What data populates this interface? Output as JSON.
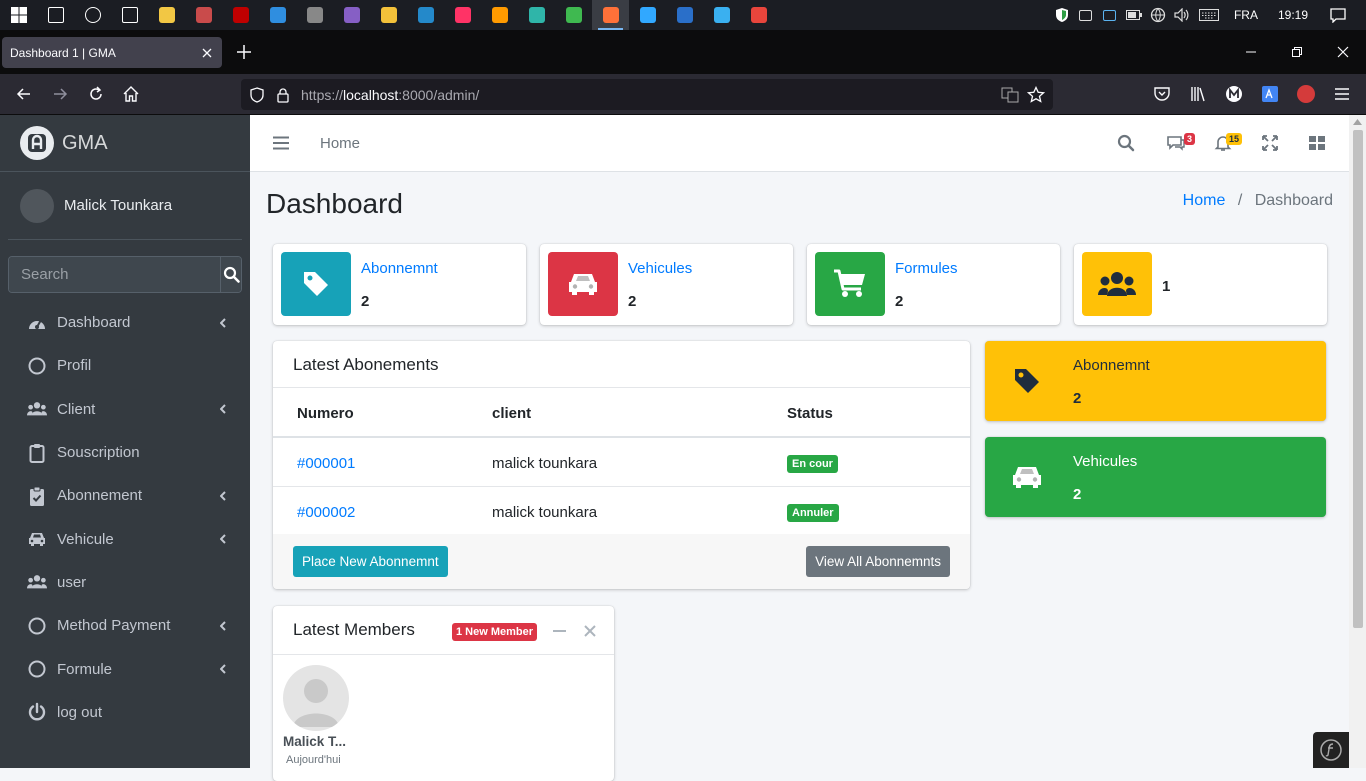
{
  "taskbar": {
    "lang": "FRA",
    "time": "19:19",
    "apps": [
      {
        "icon": "search-icon",
        "color": "#ffffff"
      },
      {
        "icon": "cortana-icon",
        "color": "#ffffff"
      },
      {
        "icon": "task-view-icon",
        "color": "#ffffff"
      },
      {
        "icon": "store-icon",
        "color": "#f2c744"
      },
      {
        "icon": "app-icon",
        "color": "#c94b4b"
      },
      {
        "icon": "filezilla-icon",
        "color": "#bf0000"
      },
      {
        "icon": "mail-icon",
        "color": "#2f8ee0"
      },
      {
        "icon": "media-icon",
        "color": "#888888"
      },
      {
        "icon": "visual-studio-icon",
        "color": "#865fc5"
      },
      {
        "icon": "explorer-icon",
        "color": "#f3c13a"
      },
      {
        "icon": "vscode-icon",
        "color": "#2489ca"
      },
      {
        "icon": "indesign-icon",
        "color": "#ff3366"
      },
      {
        "icon": "illustrator-icon",
        "color": "#ff9a00"
      },
      {
        "icon": "edge-icon",
        "color": "#2fb5a9"
      },
      {
        "icon": "app-icon",
        "color": "#3fb950"
      },
      {
        "icon": "firefox-icon",
        "color": "#ff7139"
      },
      {
        "icon": "photoshop-icon",
        "color": "#31a8ff"
      },
      {
        "icon": "powershell-icon",
        "color": "#2a6fc9"
      },
      {
        "icon": "app-icon",
        "color": "#3ab0f0"
      },
      {
        "icon": "chrome-icon",
        "color": "#e8453c"
      }
    ]
  },
  "browser": {
    "tab_title": "Dashboard 1 | GMA",
    "url_scheme": "https://",
    "url_host": "localhost",
    "url_rest": ":8000/admin/"
  },
  "sidebar": {
    "brand": "GMA",
    "user": "Malick Tounkara",
    "search_placeholder": "Search",
    "items": [
      {
        "label": "Dashboard",
        "icon": "tachometer-icon",
        "arrow": true
      },
      {
        "label": "Profil",
        "icon": "circle-icon",
        "arrow": false
      },
      {
        "label": "Client",
        "icon": "users-icon",
        "arrow": true
      },
      {
        "label": "Souscription",
        "icon": "clipboard-icon",
        "arrow": false
      },
      {
        "label": "Abonnement",
        "icon": "clipboard-check-icon",
        "arrow": true
      },
      {
        "label": "Vehicule",
        "icon": "car-icon",
        "arrow": true
      },
      {
        "label": "user",
        "icon": "users-icon",
        "arrow": false
      },
      {
        "label": "Method Payment",
        "icon": "circle-icon",
        "arrow": true
      },
      {
        "label": "Formule",
        "icon": "circle-icon",
        "arrow": true
      },
      {
        "label": "log out",
        "icon": "power-icon",
        "arrow": false
      }
    ]
  },
  "topnav": {
    "home": "Home",
    "messages_count": "3",
    "notifications_count": "15"
  },
  "header": {
    "title": "Dashboard",
    "breadcrumb_home": "Home",
    "breadcrumb_sep": "/",
    "breadcrumb_current": "Dashboard"
  },
  "info_boxes": [
    {
      "label": "Abonnemnt",
      "value": "2",
      "color": "#17a2b8",
      "icon": "tag-icon"
    },
    {
      "label": "Vehicules",
      "value": "2",
      "color": "#dc3545",
      "icon": "car-icon"
    },
    {
      "label": "Formules",
      "value": "2",
      "color": "#28a745",
      "icon": "cart-icon"
    },
    {
      "label": "",
      "value": "1",
      "color": "#ffc107",
      "icon": "users-icon"
    }
  ],
  "latest_abonements": {
    "title": "Latest Abonements",
    "headers": [
      "Numero",
      "client",
      "Status"
    ],
    "rows": [
      {
        "numero": "#000001",
        "client": "malick tounkara",
        "status": "En cour"
      },
      {
        "numero": "#000002",
        "client": "malick tounkara",
        "status": "Annuler"
      }
    ],
    "btn_new": "Place New Abonnemnt",
    "btn_all": "View All Abonnemnts"
  },
  "small_boxes": [
    {
      "label": "Abonnemnt",
      "value": "2",
      "color": "#ffc107",
      "icon": "tag-icon"
    },
    {
      "label": "Vehicules",
      "value": "2",
      "color": "#28a745",
      "icon": "car-icon"
    }
  ],
  "latest_members": {
    "title": "Latest Members",
    "badge": "1 New Member",
    "member_name": "Malick T...",
    "member_date": "Aujourd'hui"
  }
}
